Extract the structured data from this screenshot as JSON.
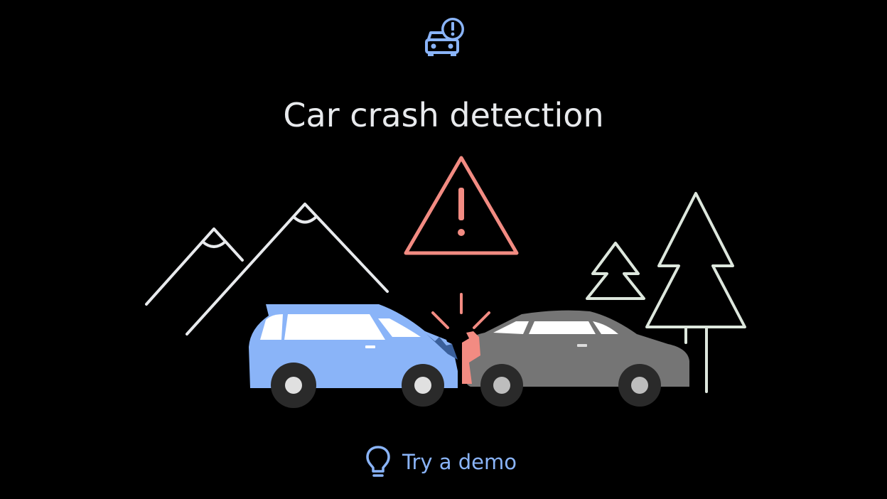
{
  "header": {
    "icon": "car-crash-alert-icon",
    "title": "Car crash detection"
  },
  "illustration": {
    "icons": [
      "mountain-icon",
      "warning-triangle-icon",
      "pine-tree-icon",
      "blue-suv-icon",
      "gray-sedan-icon",
      "impact-burst-icon"
    ]
  },
  "actions": {
    "demo_label": "Try a demo",
    "demo_icon": "lightbulb-icon"
  },
  "colors": {
    "background": "#000000",
    "accent": "#8ab4f8",
    "warning": "#f28b82",
    "title": "#e8eaed"
  }
}
